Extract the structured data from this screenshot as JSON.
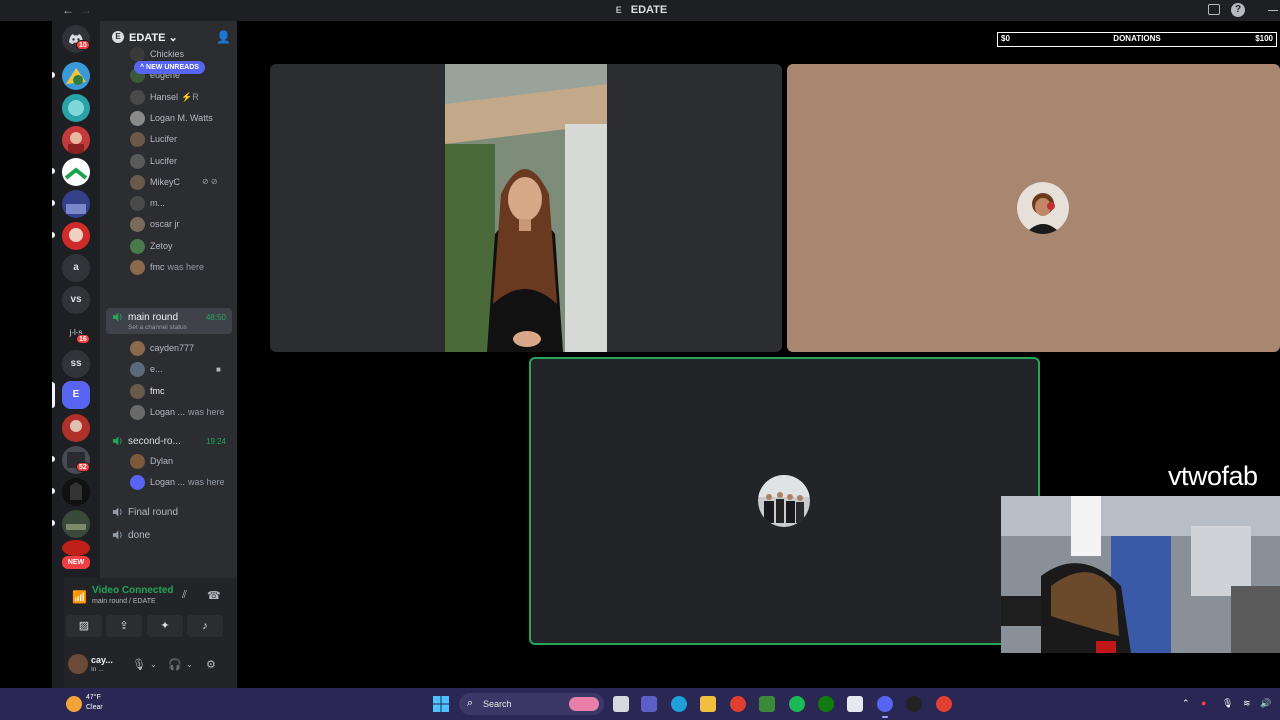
{
  "titlebar": {
    "title": "EDATE",
    "title_icon": "E"
  },
  "server": {
    "name": "EDATE",
    "icon_letter": "E",
    "new_unreads": "NEW UNREADS"
  },
  "rail": {
    "text_servers": [
      "a",
      "vs",
      "ss",
      "E"
    ],
    "badges": [
      "10",
      "16",
      "52"
    ],
    "new_label": "NEW"
  },
  "members_top": [
    {
      "name": "Chickies",
      "sub": ""
    },
    {
      "name": "eugene",
      "sub": ""
    },
    {
      "name": "Hansel",
      "sub": "⚡R"
    },
    {
      "name": "Logan M. Watts",
      "sub": ""
    },
    {
      "name": "Lucifer",
      "sub": ""
    },
    {
      "name": "Lucifer",
      "sub": ""
    },
    {
      "name": "MikeyC",
      "sub": ""
    },
    {
      "name": "m...",
      "sub": ""
    },
    {
      "name": "oscar jr",
      "sub": ""
    },
    {
      "name": "Zetoy",
      "sub": ""
    },
    {
      "name": "fmc",
      "sub": "was here"
    }
  ],
  "channels": {
    "main_round": {
      "name": "main round",
      "timer": "48:50",
      "status": "Set a channel status"
    },
    "main_members": [
      {
        "name": "cayden777",
        "sub": ""
      },
      {
        "name": "e...",
        "sub": ""
      },
      {
        "name": "fmc",
        "sub": ""
      },
      {
        "name": "Logan ...",
        "sub": "was here"
      }
    ],
    "second_round": {
      "name": "second-ro...",
      "timer": "19:24"
    },
    "second_members": [
      {
        "name": "Dylan",
        "sub": ""
      },
      {
        "name": "Logan ...",
        "sub": "was here"
      }
    ],
    "final_round": {
      "name": "Final round"
    },
    "done": {
      "name": "done"
    }
  },
  "voice_panel": {
    "title": "Video Connected",
    "subtitle": "main round / EDATE"
  },
  "user": {
    "name": "cay...",
    "status": "In ..."
  },
  "donations": {
    "min": "$0",
    "label": "DONATIONS",
    "max": "$100",
    "progress_percent": 0
  },
  "stream": {
    "streamer_name": "vtwofab"
  },
  "taskbar": {
    "temperature": "47°F",
    "condition": "Clear",
    "search_placeholder": "Search"
  },
  "colors": {
    "accent": "#5865f2",
    "connected": "#23a55a",
    "danger": "#f23f43",
    "taskbar": "#2a2755"
  }
}
